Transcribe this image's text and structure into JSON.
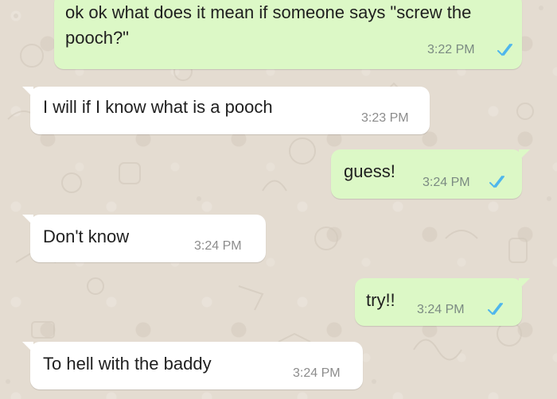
{
  "messages": [
    {
      "direction": "outgoing",
      "text": "ok ok what does it mean if someone says \"screw the pooch?\"",
      "time": "3:22 PM",
      "read_ticks": "double-check-icon",
      "tick_color": "#4fb6ec"
    },
    {
      "direction": "incoming",
      "text": "I will if I know what is a pooch",
      "time": "3:23 PM"
    },
    {
      "direction": "outgoing",
      "text": "guess!",
      "time": "3:24 PM",
      "read_ticks": "double-check-icon",
      "tick_color": "#4fb6ec"
    },
    {
      "direction": "incoming",
      "text": "Don't know",
      "time": "3:24 PM"
    },
    {
      "direction": "outgoing",
      "text": "try!!",
      "time": "3:24 PM",
      "read_ticks": "double-check-icon",
      "tick_color": "#4fb6ec"
    },
    {
      "direction": "incoming",
      "text": "To hell with the baddy",
      "time": "3:24 PM"
    }
  ],
  "colors": {
    "wallpaper": "#e4dcd1",
    "outgoing_bubble": "#dcf8c6",
    "incoming_bubble": "#ffffff",
    "read_tick": "#4fb6ec"
  }
}
